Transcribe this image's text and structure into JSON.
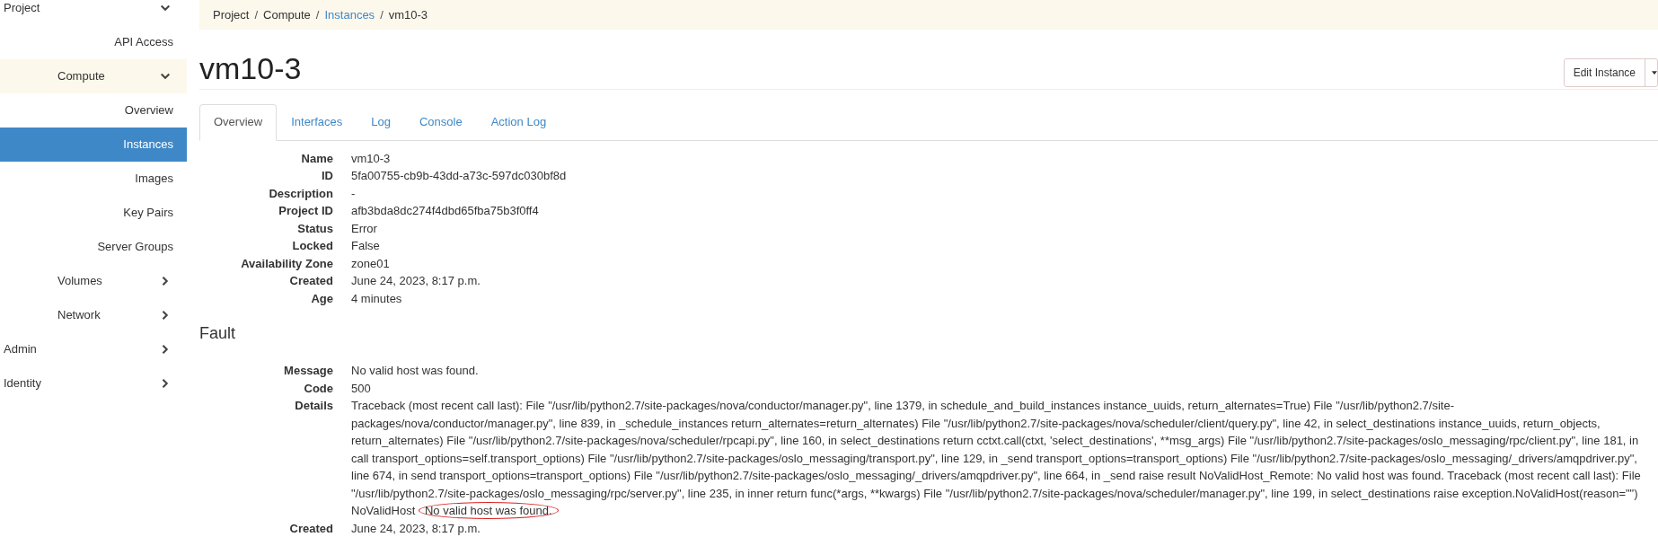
{
  "sidebar": {
    "items": [
      {
        "label": "Project",
        "expanded": true,
        "children": [
          {
            "label": "API Access",
            "selected": false
          },
          {
            "label": "Compute",
            "expanded": true,
            "children": [
              {
                "label": "Overview",
                "selected": false
              },
              {
                "label": "Instances",
                "selected": true
              },
              {
                "label": "Images",
                "selected": false
              },
              {
                "label": "Key Pairs",
                "selected": false
              },
              {
                "label": "Server Groups",
                "selected": false
              }
            ]
          },
          {
            "label": "Volumes",
            "expanded": false
          },
          {
            "label": "Network",
            "expanded": false
          }
        ]
      },
      {
        "label": "Admin",
        "expanded": false
      },
      {
        "label": "Identity",
        "expanded": false
      }
    ]
  },
  "breadcrumb": [
    {
      "label": "Project",
      "link": false,
      "separator": "/"
    },
    {
      "label": "Compute",
      "link": false,
      "separator": "/"
    },
    {
      "label": "Instances",
      "link": true,
      "separator": "/"
    },
    {
      "label": "vm10-3",
      "link": false
    }
  ],
  "page_title": "vm10-3",
  "actions": {
    "button": "Edit Instance"
  },
  "tabs": [
    {
      "label": "Overview",
      "selected": true
    },
    {
      "label": "Interfaces",
      "selected": false
    },
    {
      "label": "Log",
      "selected": false
    },
    {
      "label": "Console",
      "selected": false
    },
    {
      "label": "Action Log",
      "selected": false
    }
  ],
  "overview": [
    {
      "label": "Name",
      "value": "vm10-3"
    },
    {
      "label": "ID",
      "value": "5fa00755-cb9b-43dd-a73c-597dc030bf8d"
    },
    {
      "label": "Description",
      "value": "-"
    },
    {
      "label": "Project ID",
      "value": "afb3bda8dc274f4dbd65fba75b3f0ff4"
    },
    {
      "label": "Status",
      "value": "Error"
    },
    {
      "label": "Locked",
      "value": "False"
    },
    {
      "label": "Availability Zone",
      "value": "zone01"
    },
    {
      "label": "Created",
      "value": "June 24, 2023, 8:17 p.m."
    },
    {
      "label": "Age",
      "value": "4 minutes"
    }
  ],
  "fault": {
    "heading": "Fault",
    "rows": [
      {
        "label": "Message",
        "value": "No valid host was found."
      },
      {
        "label": "Code",
        "value": "500"
      },
      {
        "label": "Details",
        "value": "Traceback (most recent call last): File \"/usr/lib/python2.7/site-packages/nova/conductor/manager.py\", line 1379, in schedule_and_build_instances instance_uuids, return_alternates=True) File \"/usr/lib/python2.7/site-packages/nova/conductor/manager.py\", line 839, in _schedule_instances return_alternates=return_alternates) File \"/usr/lib/python2.7/site-packages/nova/scheduler/client/query.py\", line 42, in select_destinations instance_uuids, return_objects, return_alternates) File \"/usr/lib/python2.7/site-packages/nova/scheduler/rpcapi.py\", line 160, in select_destinations return cctxt.call(ctxt, 'select_destinations', **msg_args) File \"/usr/lib/python2.7/site-packages/oslo_messaging/rpc/client.py\", line 181, in call transport_options=self.transport_options) File \"/usr/lib/python2.7/site-packages/oslo_messaging/transport.py\", line 129, in _send transport_options=transport_options) File \"/usr/lib/python2.7/site-packages/oslo_messaging/_drivers/amqpdriver.py\", line 674, in send transport_options=transport_options) File \"/usr/lib/python2.7/site-packages/oslo_messaging/_drivers/amqpdriver.py\", line 664, in _send raise result NoValidHost_Remote: No valid host was found. Traceback (most recent call last): File \"/usr/lib/python2.7/site-packages/oslo_messaging/rpc/server.py\", line 235, in inner return func(*args, **kwargs) File \"/usr/lib/python2.7/site-packages/nova/scheduler/manager.py\", line 199, in select_destinations raise exception.NoValidHost(reason=\"\") NoValidHost",
        "highlight": "No valid host was found."
      },
      {
        "label": "Created",
        "value": "June 24, 2023, 8:17 p.m."
      }
    ]
  }
}
